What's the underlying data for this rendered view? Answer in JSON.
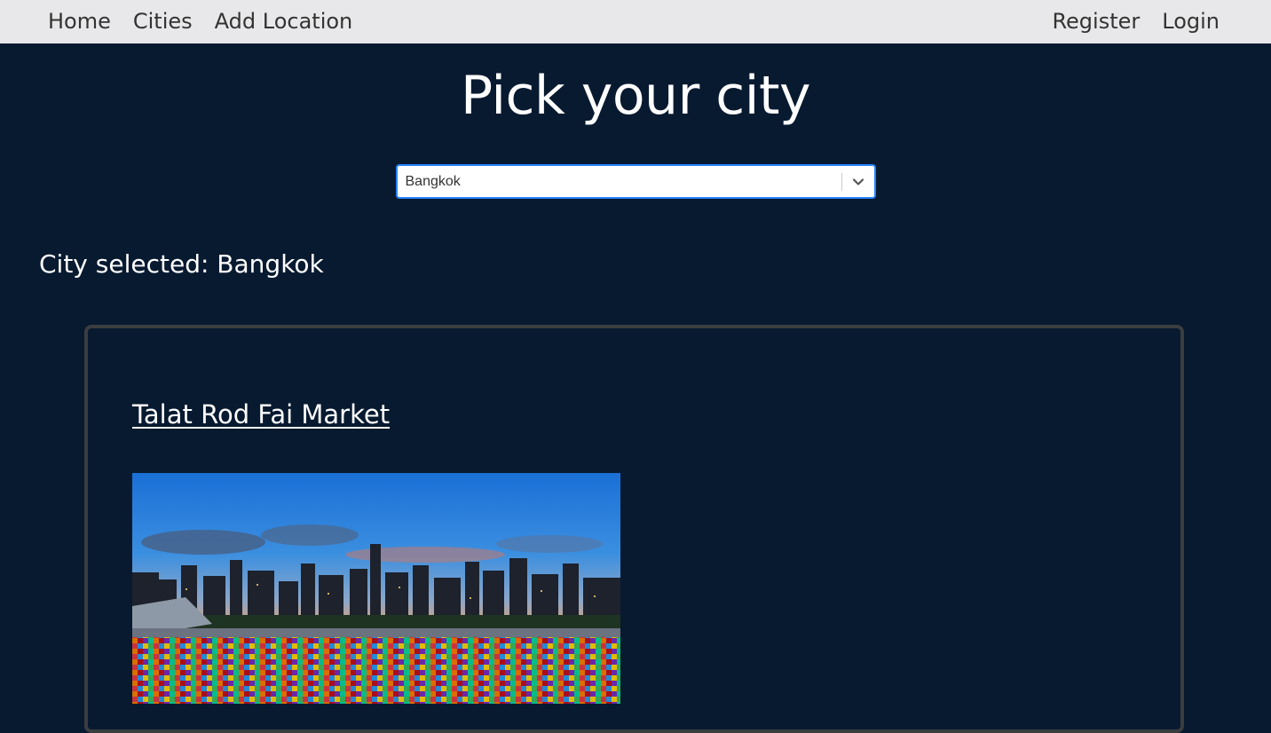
{
  "nav": {
    "home": "Home",
    "cities": "Cities",
    "add_location": "Add Location",
    "register": "Register",
    "login": "Login"
  },
  "main": {
    "title": "Pick your city",
    "city_select": {
      "value": "Bangkok"
    },
    "city_selected_text": "City selected: Bangkok"
  },
  "location_card": {
    "title": "Talat Rod Fai Market",
    "image_icon": "market-photo"
  },
  "colors": {
    "background": "#081a30",
    "navbar": "#e8e8ea",
    "select_focus": "#2684ff",
    "card_border": "#3b3d3f"
  }
}
